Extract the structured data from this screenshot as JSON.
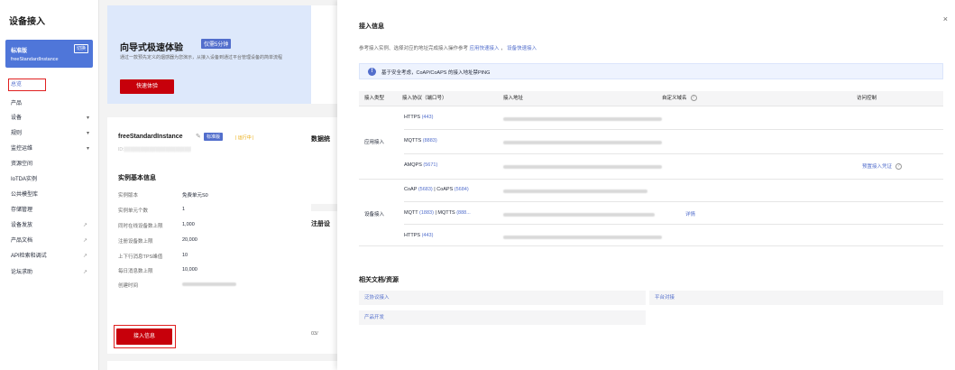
{
  "sidebar": {
    "title": "设备接入",
    "instance": {
      "version": "标准版",
      "switch_label": "切换",
      "name": "freeStandardInstance"
    },
    "items": [
      {
        "label": "总览",
        "chevron": "",
        "ext": ""
      },
      {
        "label": "产品",
        "chevron": "",
        "ext": ""
      },
      {
        "label": "设备",
        "chevron": "▾",
        "ext": ""
      },
      {
        "label": "规则",
        "chevron": "▾",
        "ext": ""
      },
      {
        "label": "监控运维",
        "chevron": "▾",
        "ext": ""
      },
      {
        "label": "资源空间",
        "chevron": "",
        "ext": ""
      },
      {
        "label": "IoTDA实例",
        "chevron": "",
        "ext": ""
      },
      {
        "label": "公共模型库",
        "chevron": "",
        "ext": ""
      },
      {
        "label": "存储管理",
        "chevron": "",
        "ext": ""
      },
      {
        "label": "设备发放",
        "chevron": "",
        "ext": "↗"
      },
      {
        "label": "产品文档",
        "chevron": "",
        "ext": "↗"
      },
      {
        "label": "API检索和调试",
        "chevron": "",
        "ext": "↗"
      },
      {
        "label": "论坛求助",
        "chevron": "",
        "ext": "↗"
      }
    ]
  },
  "hero": {
    "title": "向导式极速体验",
    "tag": "仅需5分钟",
    "desc": "通过一款预先定义的烟感器为您演示，从接入设备到通过平台管理设备的简单流程",
    "button": "快速体验"
  },
  "instance_panel": {
    "name": "freeStandardInstance",
    "badge": "标准版",
    "status": "| 运行中 |",
    "section_title": "实例基本信息",
    "rows": [
      {
        "label": "实例版本",
        "value": "免费单元S0"
      },
      {
        "label": "实例单元个数",
        "value": "1"
      },
      {
        "label": "同时在线设备数上限",
        "value": "1,000"
      },
      {
        "label": "注册设备数上限",
        "value": "20,000"
      },
      {
        "label": "上下行消息TPS峰值",
        "value": "10"
      },
      {
        "label": "每日消息数上限",
        "value": "10,000"
      },
      {
        "label": "创建时间",
        "value": ""
      }
    ],
    "button": "接入信息"
  },
  "stubs": {
    "data_title": "数据统",
    "reg_title": "注册设",
    "date_fragment": "03/"
  },
  "drawer": {
    "title": "接入信息",
    "close": "×",
    "desc_prefix": "参考接入实例、选择对应的地址完成接入操作参考",
    "link1": "应用快速接入",
    "sep": "，",
    "link2": "设备快速接入",
    "alert": "基于安全考虑，CoAP/CoAPS 的接入地址禁PING",
    "headers": {
      "type": "接入类型",
      "protocol": "接入协议（端口号）",
      "address": "接入地址",
      "domain": "自定义域名",
      "access": "访问控制"
    },
    "app_group": {
      "type": "应用接入",
      "rows": [
        {
          "proto": "HTTPS",
          "port": "(443)"
        },
        {
          "proto": "MQTTS",
          "port": "(8883)"
        },
        {
          "proto": "AMQPS",
          "port": "(5671)",
          "access": "预置接入凭证"
        }
      ]
    },
    "device_group": {
      "type": "设备接入",
      "rows": [
        {
          "proto": "CoAP",
          "port": "(5683)",
          "sep": "|",
          "proto2": "CoAPS",
          "port2": "(5684)"
        },
        {
          "proto": "MQTT",
          "port": "(1883)",
          "sep": "|",
          "proto2": "MQTTS",
          "port2": "(888...",
          "domain": "详情"
        },
        {
          "proto": "HTTPS",
          "port": "(443)"
        }
      ]
    },
    "docs": {
      "title": "相关文档/资源",
      "items": [
        "泛协议接入",
        "平台对接",
        "产品开发"
      ]
    }
  }
}
